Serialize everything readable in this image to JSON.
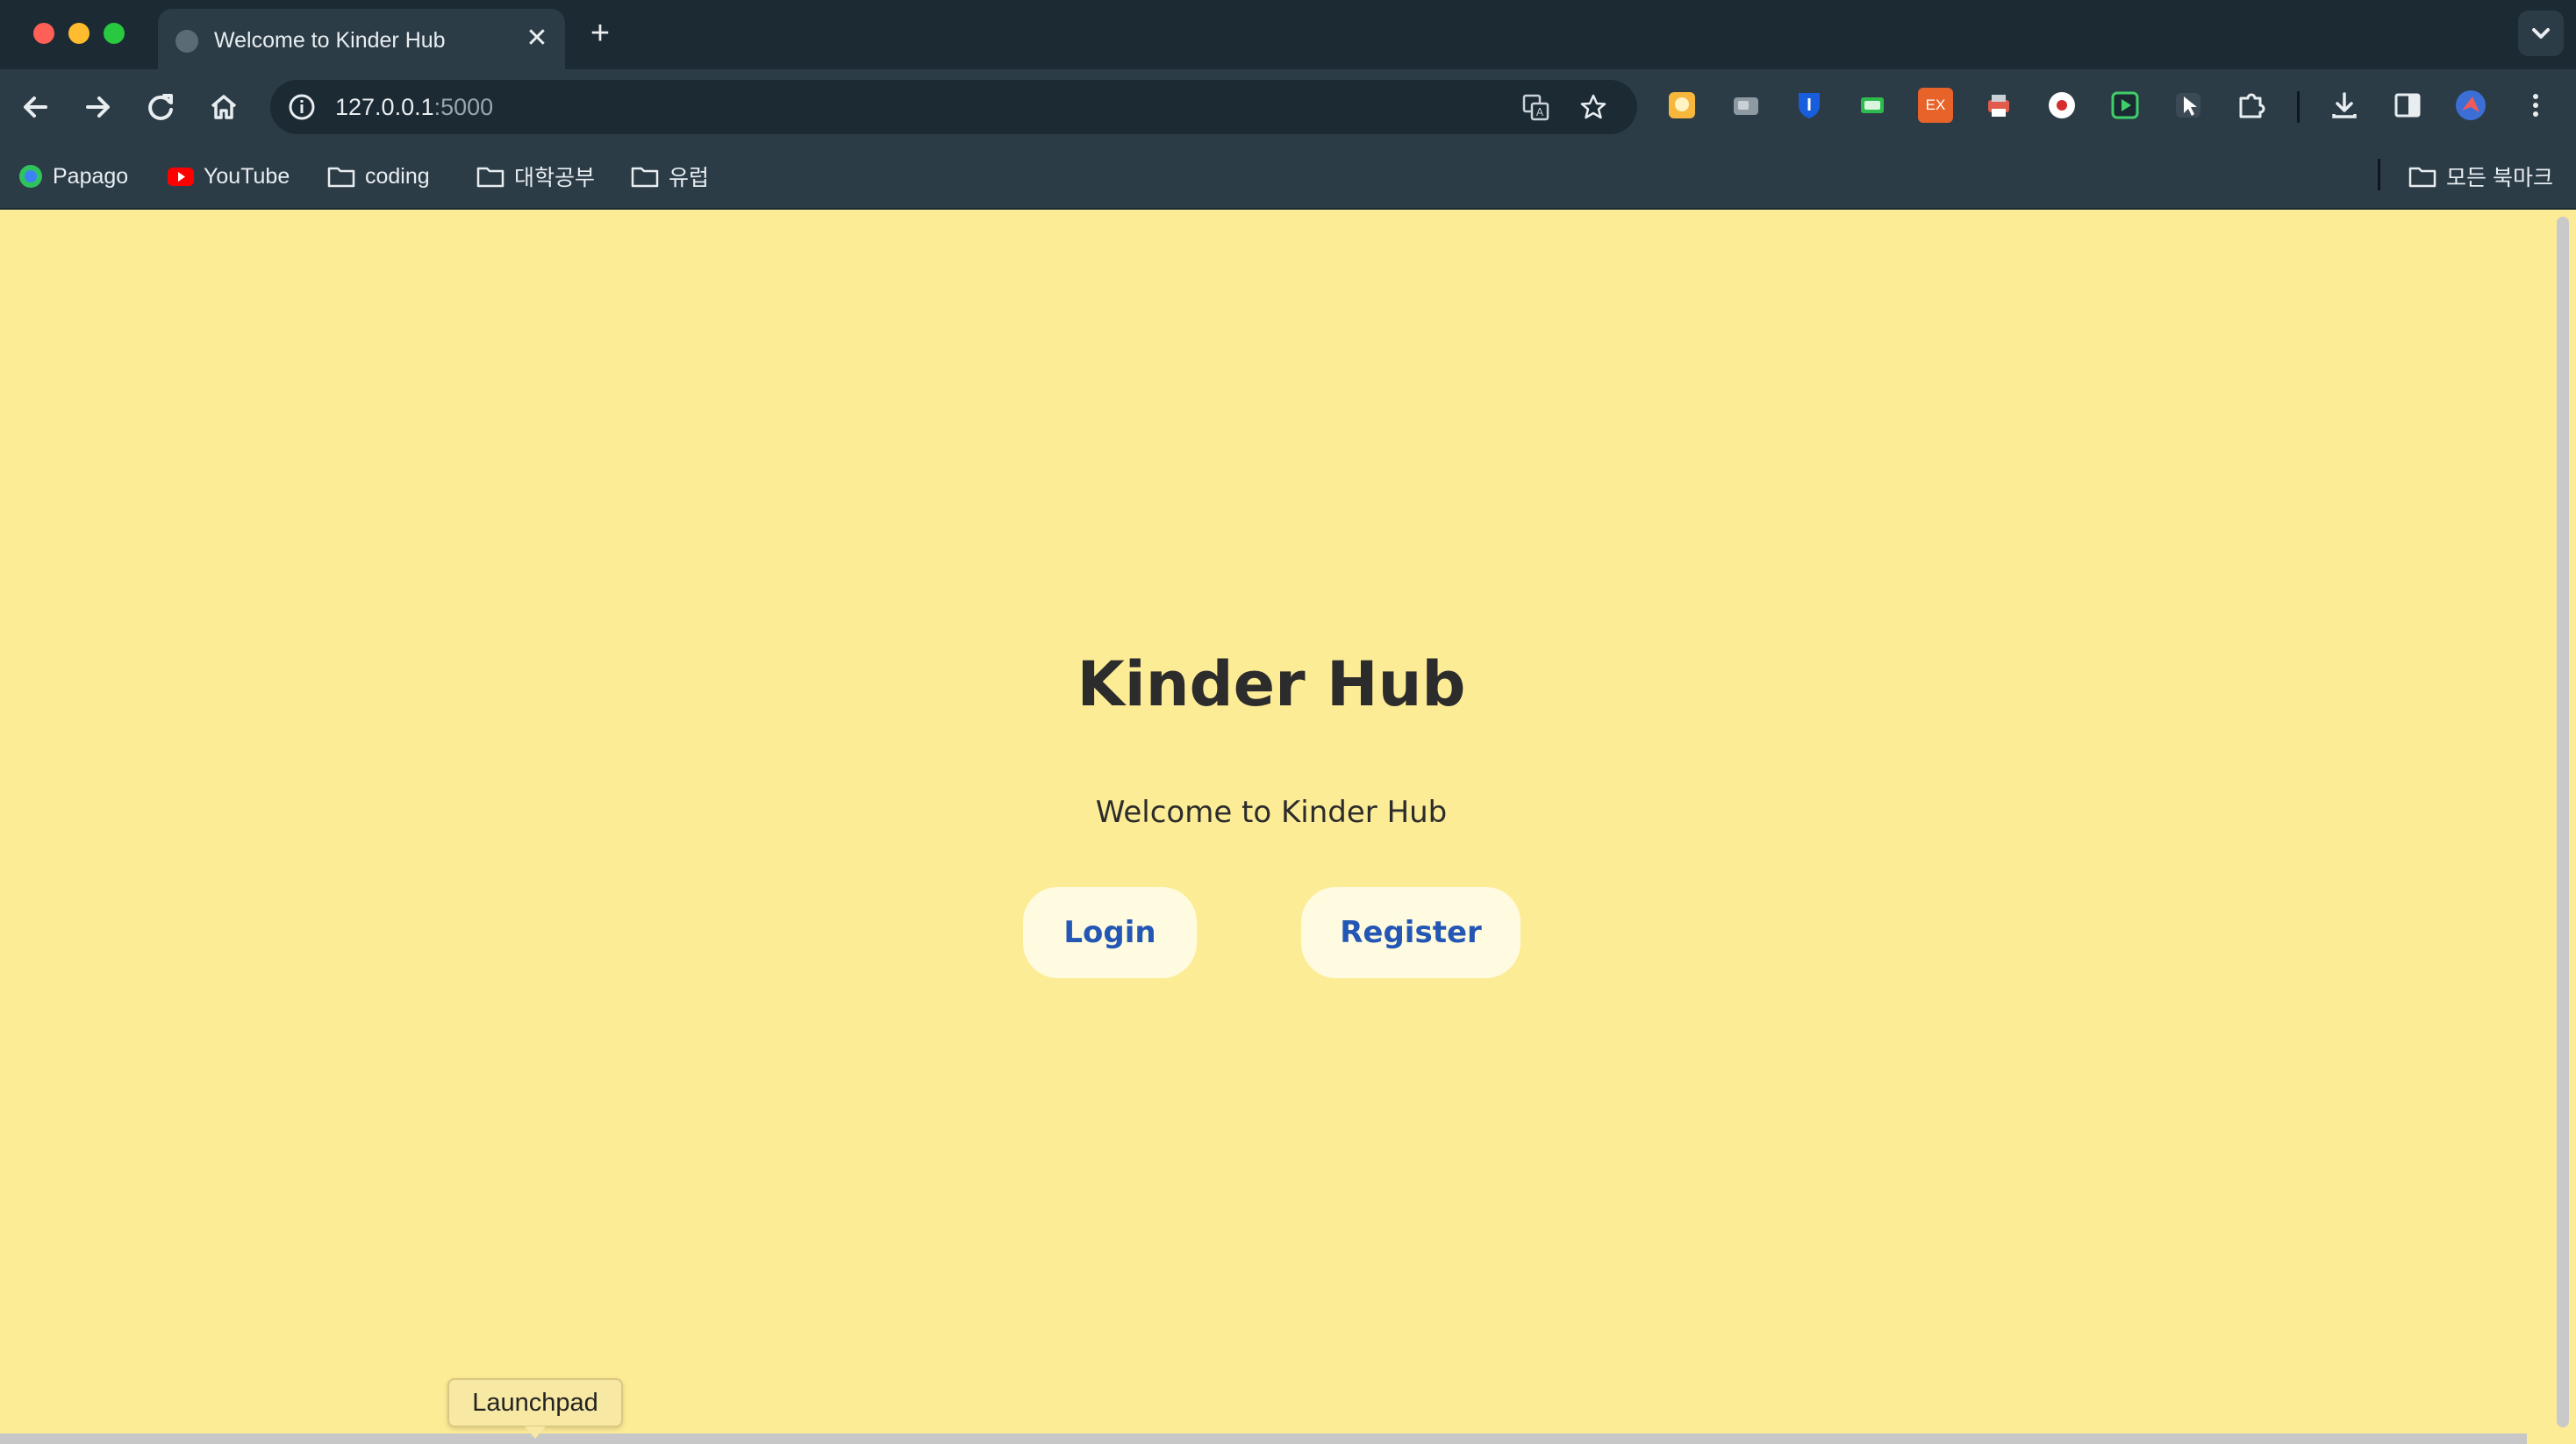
{
  "browser": {
    "tab": {
      "title": "Welcome to Kinder Hub",
      "close_glyph": "✕"
    },
    "new_tab_glyph": "+",
    "address": {
      "host": "127.0.0.1",
      "port": ":5000"
    },
    "bookmarks": [
      {
        "label": "Papago",
        "icon": "papago-icon"
      },
      {
        "label": "YouTube",
        "icon": "youtube-icon"
      },
      {
        "label": "coding",
        "icon": "folder-icon"
      },
      {
        "label": "대학공부",
        "icon": "folder-icon"
      },
      {
        "label": "유럽",
        "icon": "folder-icon"
      }
    ],
    "all_bookmarks": "모든 북마크",
    "extensions": [
      "yellow-extension-icon",
      "gray-extension-icon",
      "bitwarden-icon",
      "green-extension-icon",
      "ex-extension-icon",
      "printer-extension-icon",
      "record-icon",
      "play-extension-icon",
      "cursor-extension-icon",
      "puzzle-icon"
    ],
    "extension_labels": {
      "ex": "EX"
    }
  },
  "page": {
    "heading": "Kinder Hub",
    "subtitle": "Welcome to Kinder Hub",
    "login_label": "Login",
    "register_label": "Register"
  },
  "dock": {
    "tooltip": "Launchpad"
  },
  "colors": {
    "page_background": "#fdec96",
    "button_background": "#fffbe0",
    "button_text": "#2457b5",
    "chrome_dark": "#1c2a33",
    "chrome_mid": "#2c3c47"
  }
}
